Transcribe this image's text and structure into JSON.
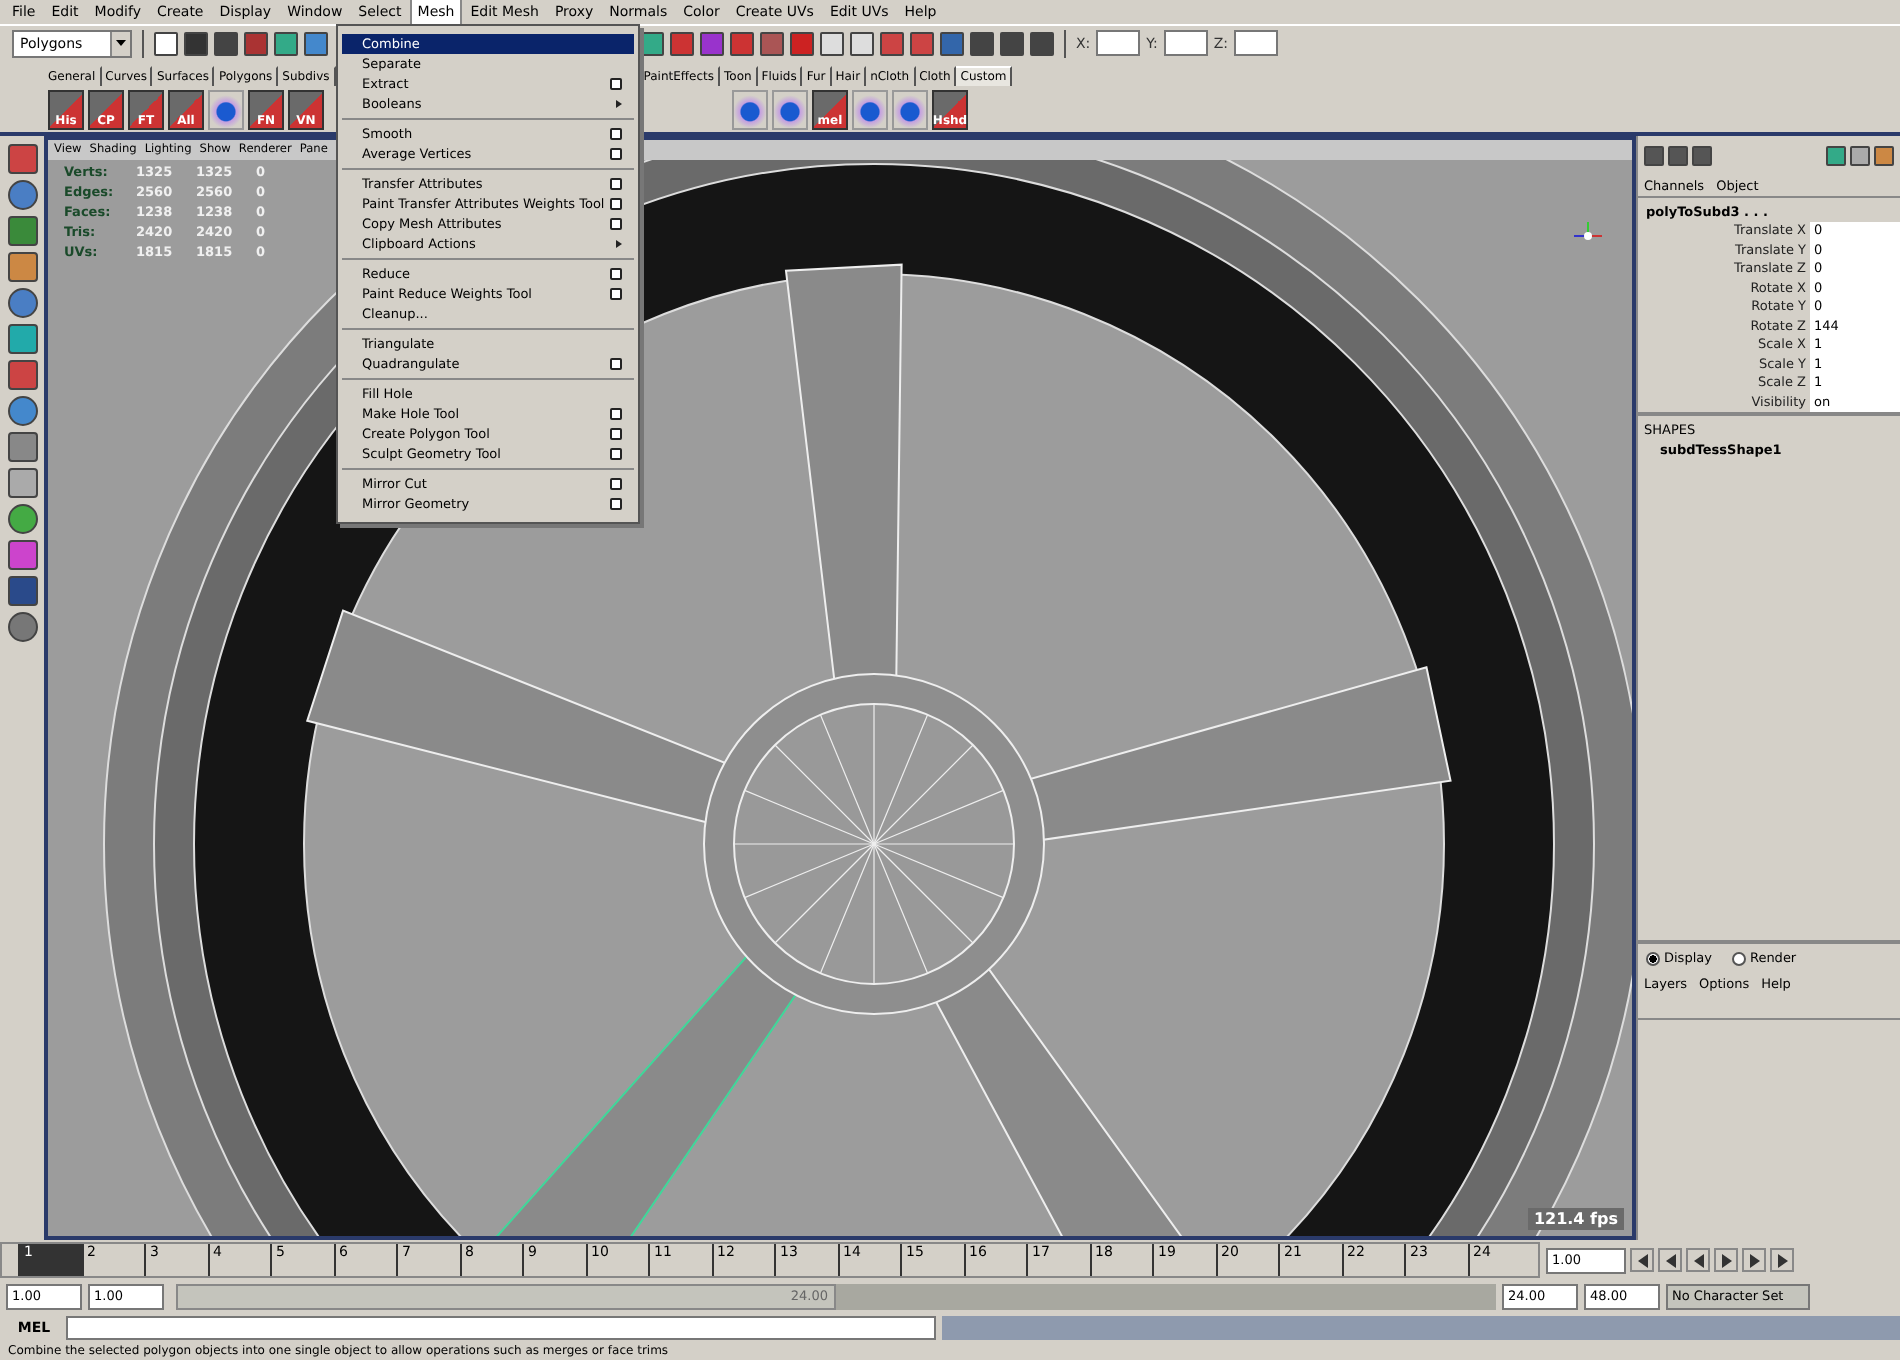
{
  "menubar": [
    {
      "label": "File",
      "selected": false
    },
    {
      "label": "Edit",
      "selected": false
    },
    {
      "label": "Modify",
      "selected": false
    },
    {
      "label": "Create",
      "selected": false
    },
    {
      "label": "Display",
      "selected": false
    },
    {
      "label": "Window",
      "selected": false
    },
    {
      "label": "Select",
      "selected": false
    },
    {
      "label": "Mesh",
      "selected": true
    },
    {
      "label": "Edit Mesh",
      "selected": false
    },
    {
      "label": "Proxy",
      "selected": false
    },
    {
      "label": "Normals",
      "selected": false
    },
    {
      "label": "Color",
      "selected": false
    },
    {
      "label": "Create UVs",
      "selected": false
    },
    {
      "label": "Edit UVs",
      "selected": false
    },
    {
      "label": "Help",
      "selected": false
    }
  ],
  "toolbar": {
    "mode": "Polygons",
    "coords": [
      {
        "label": "X:"
      },
      {
        "label": "Y:"
      },
      {
        "label": "Z:"
      }
    ]
  },
  "shelf_tabs": [
    {
      "label": "General",
      "selected": false
    },
    {
      "label": "Curves",
      "selected": false
    },
    {
      "label": "Surfaces",
      "selected": false
    },
    {
      "label": "Polygons",
      "selected": false
    },
    {
      "label": "Subdivs",
      "selected": false
    },
    {
      "label": "PaintEffects",
      "selected": false
    },
    {
      "label": "Toon",
      "selected": false
    },
    {
      "label": "Fluids",
      "selected": false
    },
    {
      "label": "Fur",
      "selected": false
    },
    {
      "label": "Hair",
      "selected": false
    },
    {
      "label": "nCloth",
      "selected": false
    },
    {
      "label": "Cloth",
      "selected": false
    },
    {
      "label": "Custom",
      "selected": true
    }
  ],
  "shelf_buttons": [
    {
      "kind": "labeled",
      "label": "His"
    },
    {
      "kind": "labeled",
      "label": "CP"
    },
    {
      "kind": "labeled",
      "label": "FT"
    },
    {
      "kind": "labeled",
      "label": "All"
    },
    {
      "kind": "icon"
    },
    {
      "kind": "labeled",
      "label": "FN"
    },
    {
      "kind": "labeled",
      "label": "VN"
    }
  ],
  "shelf_buttons_right": [
    {
      "kind": "icon"
    },
    {
      "kind": "icon"
    },
    {
      "kind": "labeled",
      "label": "mel"
    },
    {
      "kind": "icon"
    },
    {
      "kind": "icon"
    },
    {
      "kind": "labeled",
      "label": "Hshd"
    }
  ],
  "mesh_menu": [
    [
      {
        "label": "Combine",
        "selected": true,
        "kind": "plain"
      },
      {
        "label": "Separate",
        "selected": false,
        "kind": "plain"
      },
      {
        "label": "Extract",
        "selected": false,
        "kind": "option"
      },
      {
        "label": "Booleans",
        "selected": false,
        "kind": "submenu"
      }
    ],
    [
      {
        "label": "Smooth",
        "selected": false,
        "kind": "option"
      },
      {
        "label": "Average Vertices",
        "selected": false,
        "kind": "option"
      }
    ],
    [
      {
        "label": "Transfer Attributes",
        "selected": false,
        "kind": "option"
      },
      {
        "label": "Paint Transfer Attributes Weights Tool",
        "selected": false,
        "kind": "option"
      },
      {
        "label": "Copy Mesh Attributes",
        "selected": false,
        "kind": "option"
      },
      {
        "label": "Clipboard Actions",
        "selected": false,
        "kind": "submenu"
      }
    ],
    [
      {
        "label": "Reduce",
        "selected": false,
        "kind": "option"
      },
      {
        "label": "Paint Reduce Weights Tool",
        "selected": false,
        "kind": "option"
      },
      {
        "label": "Cleanup...",
        "selected": false,
        "kind": "plain"
      }
    ],
    [
      {
        "label": "Triangulate",
        "selected": false,
        "kind": "plain"
      },
      {
        "label": "Quadrangulate",
        "selected": false,
        "kind": "option"
      }
    ],
    [
      {
        "label": "Fill Hole",
        "selected": false,
        "kind": "plain"
      },
      {
        "label": "Make Hole Tool",
        "selected": false,
        "kind": "option"
      },
      {
        "label": "Create Polygon Tool",
        "selected": false,
        "kind": "option"
      },
      {
        "label": "Sculpt Geometry Tool",
        "selected": false,
        "kind": "option"
      }
    ],
    [
      {
        "label": "Mirror Cut",
        "selected": false,
        "kind": "option"
      },
      {
        "label": "Mirror Geometry",
        "selected": false,
        "kind": "option"
      }
    ]
  ],
  "viewport": {
    "menu": [
      "View",
      "Shading",
      "Lighting",
      "Show",
      "Renderer",
      "Pane"
    ],
    "stats": [
      {
        "name": "Verts:",
        "values": [
          "1325",
          "1325",
          "0"
        ]
      },
      {
        "name": "Edges:",
        "values": [
          "2560",
          "2560",
          "0"
        ]
      },
      {
        "name": "Faces:",
        "values": [
          "1238",
          "1238",
          "0"
        ]
      },
      {
        "name": "Tris:",
        "values": [
          "2420",
          "2420",
          "0"
        ]
      },
      {
        "name": "UVs:",
        "values": [
          "1815",
          "1815",
          "0"
        ]
      }
    ],
    "fps": "121.4 fps"
  },
  "channel_box": {
    "tabs": [
      "Channels",
      "Object"
    ],
    "node": "polyToSubd3 . . .",
    "attributes": [
      {
        "name": "Translate X",
        "value": "0"
      },
      {
        "name": "Translate Y",
        "value": "0"
      },
      {
        "name": "Translate Z",
        "value": "0"
      },
      {
        "name": "Rotate X",
        "value": "0"
      },
      {
        "name": "Rotate Y",
        "value": "0"
      },
      {
        "name": "Rotate Z",
        "value": "144"
      },
      {
        "name": "Scale X",
        "value": "1"
      },
      {
        "name": "Scale Y",
        "value": "1"
      },
      {
        "name": "Scale Z",
        "value": "1"
      },
      {
        "name": "Visibility",
        "value": "on"
      }
    ],
    "shapes_heading": "SHAPES",
    "shape": "subdTessShape1"
  },
  "layer_editor": {
    "modes": [
      {
        "label": "Display",
        "selected": true
      },
      {
        "label": "Render",
        "selected": false
      }
    ],
    "menu": [
      "Layers",
      "Options",
      "Help"
    ]
  },
  "timeline": {
    "frames": [
      {
        "label": "1",
        "selected": true
      },
      {
        "label": "2",
        "selected": false
      },
      {
        "label": "3",
        "selected": false
      },
      {
        "label": "4",
        "selected": false
      },
      {
        "label": "5",
        "selected": false
      },
      {
        "label": "6",
        "selected": false
      },
      {
        "label": "7",
        "selected": false
      },
      {
        "label": "8",
        "selected": false
      },
      {
        "label": "9",
        "selected": false
      },
      {
        "label": "10",
        "selected": false
      },
      {
        "label": "11",
        "selected": false
      },
      {
        "label": "12",
        "selected": false
      },
      {
        "label": "13",
        "selected": false
      },
      {
        "label": "14",
        "selected": false
      },
      {
        "label": "15",
        "selected": false
      },
      {
        "label": "16",
        "selected": false
      },
      {
        "label": "17",
        "selected": false
      },
      {
        "label": "18",
        "selected": false
      },
      {
        "label": "19",
        "selected": false
      },
      {
        "label": "20",
        "selected": false
      },
      {
        "label": "21",
        "selected": false
      },
      {
        "label": "22",
        "selected": false
      },
      {
        "label": "23",
        "selected": false
      },
      {
        "label": "24",
        "selected": false
      }
    ],
    "current_time": "1.00"
  },
  "range": {
    "start": "1.00",
    "range_start": "1.00",
    "range_end_label": "24.00",
    "end": "24.00",
    "anim_end": "48.00",
    "character_set": "No Character Set",
    "level": 0.5
  },
  "command_line": {
    "label": "MEL"
  },
  "help_line": "Combine the selected polygon objects into one single object to allow operations such as merges or face trims"
}
